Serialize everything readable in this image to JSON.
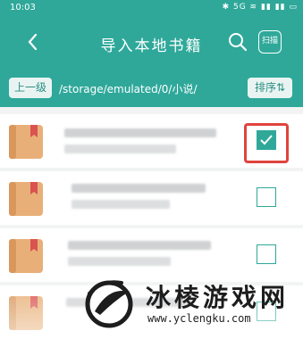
{
  "statusbar": {
    "time": "10:03",
    "icons_text": "✱ 5G ≋ ▮▮ ▮▮ ▭"
  },
  "titlebar": {
    "back_icon": "chevron-left-icon",
    "title": "导入本地书籍",
    "search_icon": "search-icon",
    "scan_label": "扫描"
  },
  "pathbar": {
    "up_label": "上一级",
    "path": "/storage/emulated/0/小说/",
    "sort_label": "排序⇅"
  },
  "files": [
    {
      "checked": true
    },
    {
      "checked": false
    },
    {
      "checked": false
    },
    {
      "checked": false
    }
  ],
  "watermark": {
    "name": "冰棱游戏网",
    "url": "www.yclengku.com"
  },
  "colors": {
    "header": "#2fa89a",
    "accent": "#2fa89a",
    "highlight": "#e0433d",
    "book": "#e8b078"
  }
}
